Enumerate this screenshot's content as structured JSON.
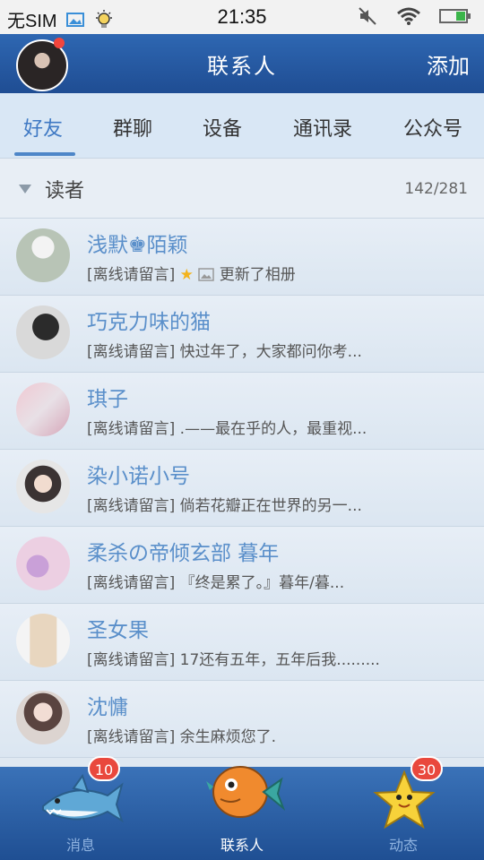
{
  "status_bar": {
    "carrier": "无SIM",
    "time": "21:35"
  },
  "header": {
    "title": "联系人",
    "add_label": "添加"
  },
  "tabs": [
    {
      "label": "好友",
      "active": true
    },
    {
      "label": "群聊",
      "active": false
    },
    {
      "label": "设备",
      "active": false
    },
    {
      "label": "通讯录",
      "active": false
    },
    {
      "label": "公众号",
      "active": false
    }
  ],
  "group": {
    "name": "读者",
    "count": "142/281"
  },
  "contacts": [
    {
      "name": "浅默♚陌颖",
      "status": "[离线请留言]",
      "message": "更新了相册"
    },
    {
      "name": "巧克力味的猫",
      "status": "[离线请留言]",
      "message": "快过年了，大家都问你考..."
    },
    {
      "name": "琪子",
      "status": "[离线请留言]",
      "message": ".——最在乎的人，最重视..."
    },
    {
      "name": "染小诺小号",
      "status": "[离线请留言]",
      "message": "倘若花瓣正在世界的另一..."
    },
    {
      "name": "柔杀の帝倾玄部 暮年",
      "status": "[离线请留言]",
      "message": "『终是累了。』暮年/暮..."
    },
    {
      "name": "圣女果",
      "status": "[离线请留言]",
      "message": "17还有五年，五年后我........."
    },
    {
      "name": "沈慵",
      "status": "[离线请留言]",
      "message": "余生麻烦您了."
    }
  ],
  "footer": {
    "messages_label": "消息",
    "messages_badge": "10",
    "contacts_label": "联系人",
    "feed_label": "动态",
    "feed_badge": "30"
  }
}
